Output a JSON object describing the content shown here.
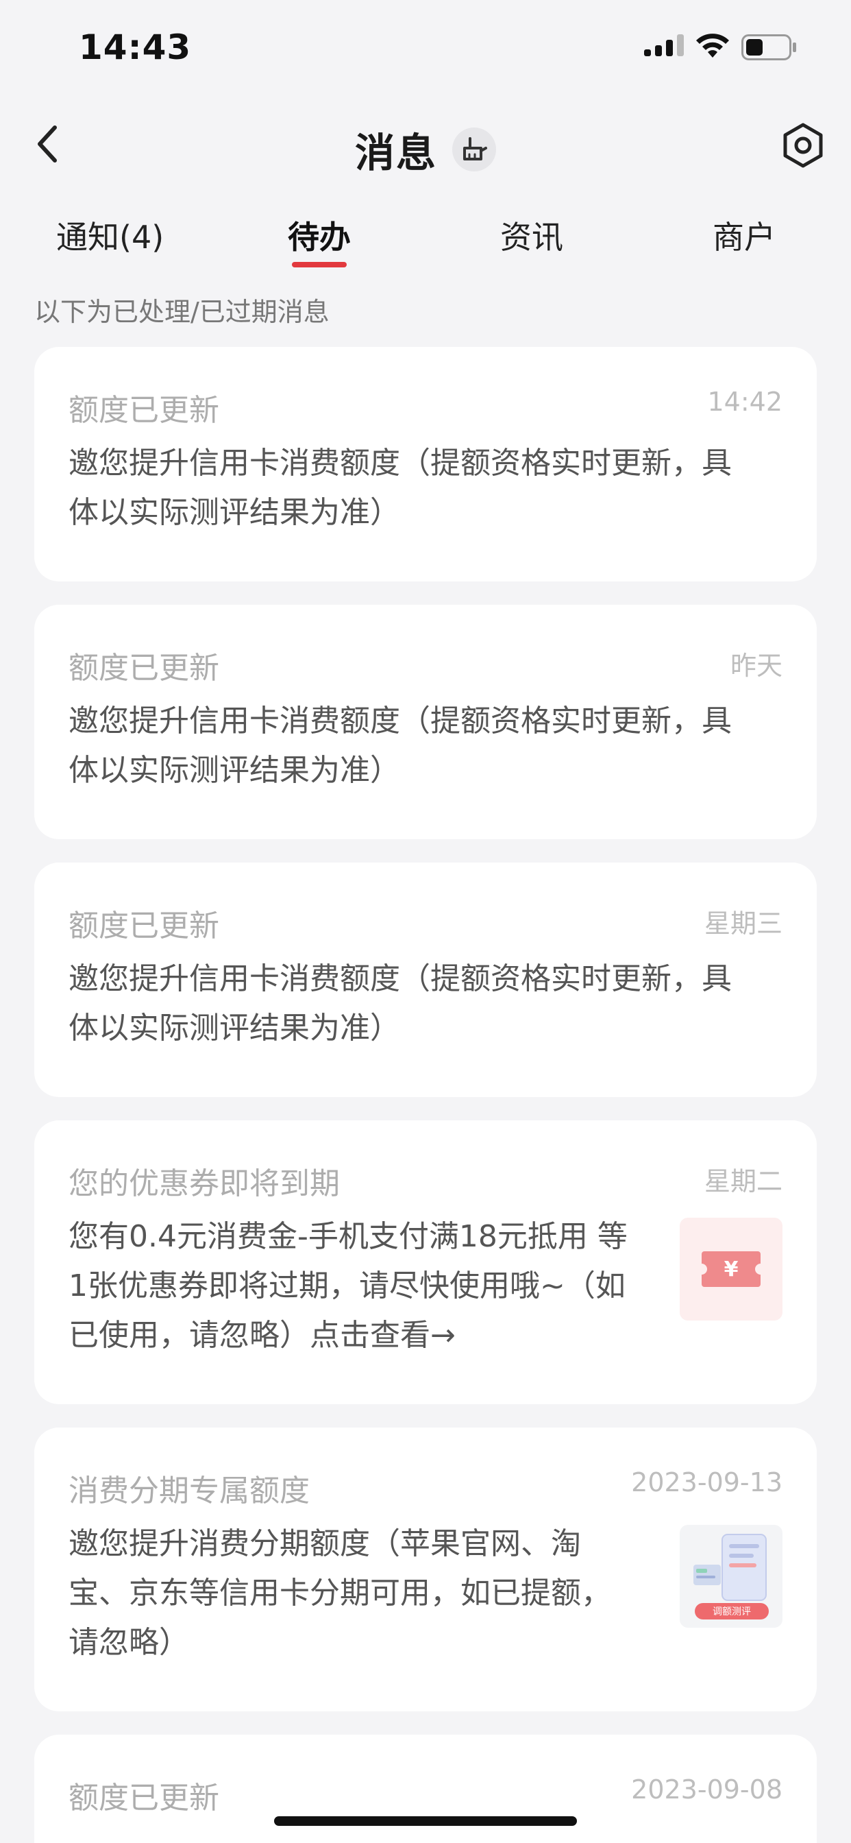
{
  "status_bar": {
    "time": "14:43"
  },
  "nav": {
    "title": "消息"
  },
  "tabs": [
    {
      "label": "通知(4)"
    },
    {
      "label": "待办"
    },
    {
      "label": "资讯"
    },
    {
      "label": "商户"
    }
  ],
  "active_tab": "待办",
  "hint": "以下为已处理/已过期消息",
  "messages": [
    {
      "title": "额度已更新",
      "date": "14:42",
      "lines": [
        "邀您提升信用卡消费额度（提额资格实时更新，具",
        "体以实际测评结果为准）"
      ]
    },
    {
      "title": "额度已更新",
      "date": "昨天",
      "lines": [
        "邀您提升信用卡消费额度（提额资格实时更新，具",
        "体以实际测评结果为准）"
      ]
    },
    {
      "title": "额度已更新",
      "date": "星期三",
      "lines": [
        "邀您提升信用卡消费额度（提额资格实时更新，具",
        "体以实际测评结果为准）"
      ]
    },
    {
      "title": "您的优惠券即将到期",
      "date": "星期二",
      "lines": [
        "您有0.4元消费金-手机支付满18元抵用 等",
        "1张优惠券即将过期，请尽快使用哦~（如",
        "已使用，请忽略）点击查看→"
      ],
      "thumb": {
        "icon": "coupon-icon",
        "glyph": "¥"
      }
    },
    {
      "title": "消费分期专属额度",
      "date": "2023-09-13",
      "lines": [
        "邀您提升消费分期额度（苹果官网、淘",
        "宝、京东等信用卡分期可用，如已提额，",
        "请忽略）"
      ],
      "thumb": {
        "icon": "credit-assessment-icon",
        "label": "调额测评"
      }
    },
    {
      "title": "额度已更新",
      "date": "2023-09-08"
    }
  ],
  "colors": {
    "accent": "#e2393e",
    "background": "#f4f4f6",
    "card": "#ffffff"
  }
}
